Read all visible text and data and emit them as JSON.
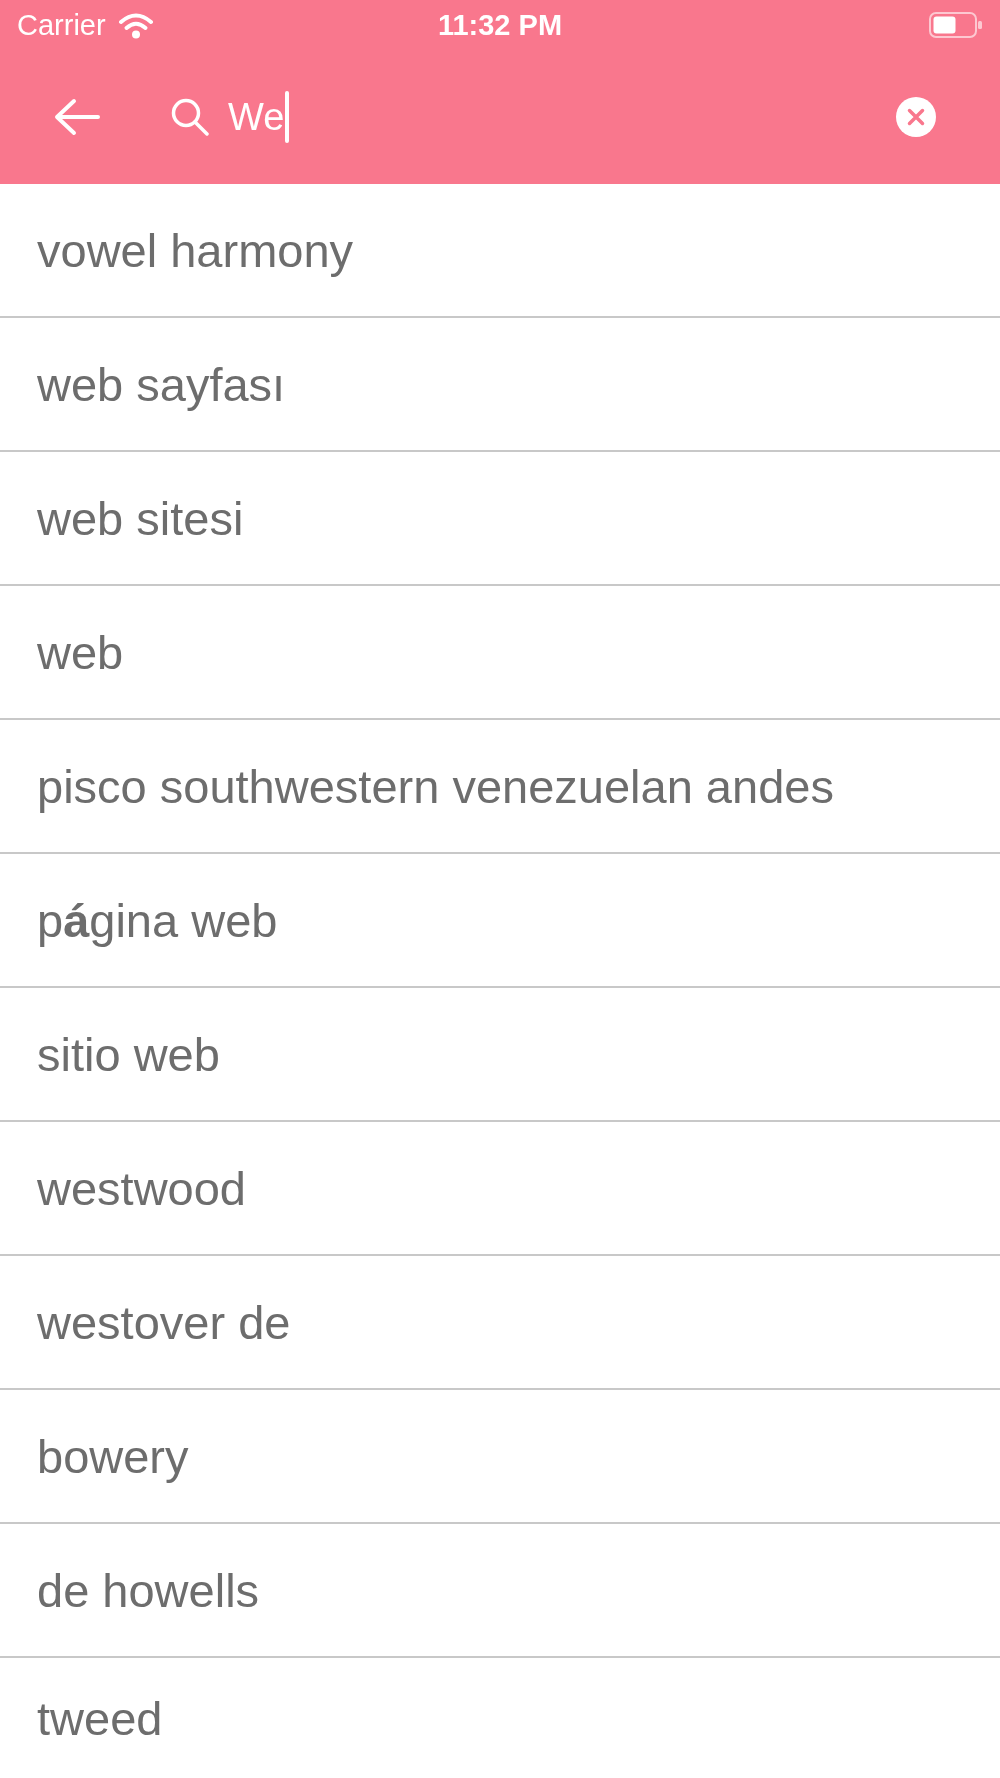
{
  "status_bar": {
    "carrier": "Carrier",
    "time": "11:32 PM"
  },
  "search": {
    "value": "We",
    "focused": true
  },
  "results": [
    "vowel harmony",
    "web sayfası",
    "web sitesi",
    "web",
    "pisco southwestern venezuelan andes",
    "p**á**gina web",
    "sitio web",
    "westwood",
    "westover de",
    "bowery",
    "de howells",
    "tweed"
  ]
}
